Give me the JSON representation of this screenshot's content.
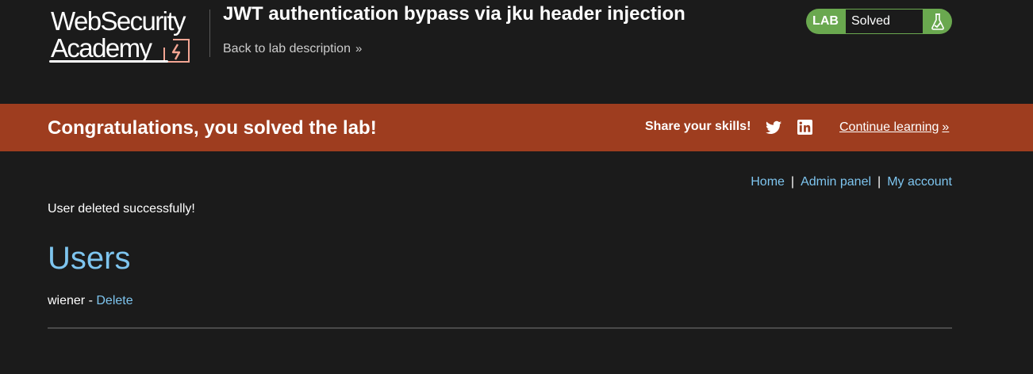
{
  "logo": {
    "line1": "WebSecurity",
    "line2": "Academy"
  },
  "header": {
    "title": "JWT authentication bypass via jku header injection",
    "back_link": "Back to lab description",
    "back_chevron": "»"
  },
  "status": {
    "label": "LAB",
    "value": "Solved",
    "icon": "flask-icon"
  },
  "banner": {
    "message": "Congratulations, you solved the lab!",
    "share_label": "Share your skills!",
    "continue_label": "Continue learning",
    "continue_chevron": "»"
  },
  "nav": {
    "home": "Home",
    "admin": "Admin panel",
    "account": "My account",
    "separator": "|"
  },
  "content": {
    "message": "User deleted successfully!",
    "heading": "Users",
    "users": [
      {
        "name": "wiener",
        "separator": " - ",
        "action": "Delete"
      }
    ]
  },
  "colors": {
    "background": "#1b1b1b",
    "banner": "#9e3d1f",
    "link": "#7ec5ef",
    "lab_green": "#6aa84f",
    "logo_accent": "#f3a593"
  }
}
